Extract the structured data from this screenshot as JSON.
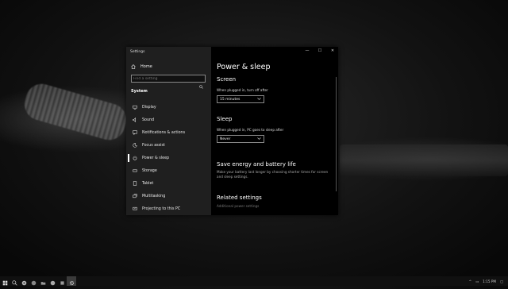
{
  "window": {
    "app_title": "Settings",
    "controls": {
      "minimize": "—",
      "maximize": "☐",
      "close": "✕"
    }
  },
  "sidebar": {
    "home_label": "Home",
    "search_placeholder": "Find a setting",
    "section_label": "System",
    "items": [
      {
        "label": "Display",
        "icon": "display-icon"
      },
      {
        "label": "Sound",
        "icon": "sound-icon"
      },
      {
        "label": "Notifications & actions",
        "icon": "notifications-icon"
      },
      {
        "label": "Focus assist",
        "icon": "focus-assist-icon"
      },
      {
        "label": "Power & sleep",
        "icon": "power-icon",
        "active": true
      },
      {
        "label": "Storage",
        "icon": "storage-icon"
      },
      {
        "label": "Tablet",
        "icon": "tablet-icon"
      },
      {
        "label": "Multitasking",
        "icon": "multitasking-icon"
      },
      {
        "label": "Projecting to this PC",
        "icon": "projecting-icon"
      }
    ]
  },
  "main": {
    "title": "Power & sleep",
    "screen": {
      "heading": "Screen",
      "label": "When plugged in, turn off after",
      "value": "15 minutes"
    },
    "sleep": {
      "heading": "Sleep",
      "label": "When plugged in, PC goes to sleep after",
      "value": "Never"
    },
    "save_energy": {
      "heading": "Save energy and battery life",
      "description": "Make your battery last longer by choosing shorter times for screen and sleep settings."
    },
    "related": {
      "heading": "Related settings",
      "link": "Additional power settings"
    }
  },
  "taskbar": {
    "time": "1:15 PM",
    "icons": [
      "start-icon",
      "search-icon",
      "chrome-icon",
      "explorer-icon",
      "spotify-icon",
      "app-icon",
      "app-icon",
      "settings-icon"
    ]
  }
}
